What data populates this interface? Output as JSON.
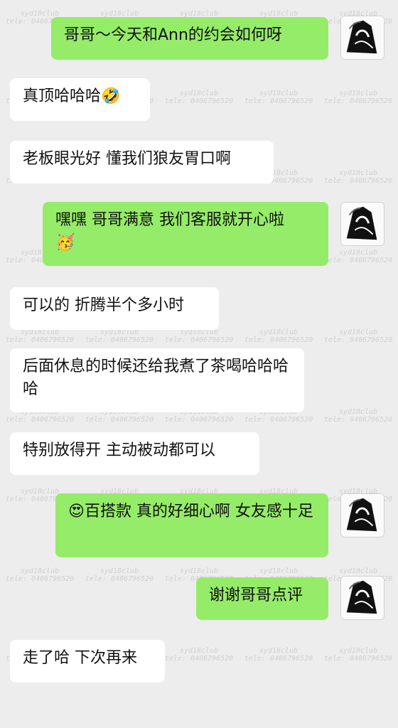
{
  "watermark": {
    "line1": "syd18club",
    "line2": "tele: 0406796520"
  },
  "messages": [
    {
      "side": "right",
      "text": "哥哥～今天和Ann的约会如何呀"
    },
    {
      "side": "left",
      "text": "真顶哈哈哈",
      "emoji": "🤣"
    },
    {
      "side": "left",
      "text": "老板眼光好 懂我们狼友胃口啊"
    },
    {
      "side": "right",
      "text": "嘿嘿 哥哥满意 我们客服就开心啦",
      "emoji": "🥳"
    },
    {
      "side": "left",
      "text": "可以的 折腾半个多小时"
    },
    {
      "side": "left",
      "text": "后面休息的时候还给我煮了茶喝哈哈哈哈"
    },
    {
      "side": "left",
      "text": "特别放得开 主动被动都可以"
    },
    {
      "side": "right",
      "text": "百搭款 真的好细心啊 女友感十足",
      "emoji": "😍"
    },
    {
      "side": "right",
      "text": "谢谢哥哥点评"
    },
    {
      "side": "left",
      "text": "走了哈 下次再来"
    }
  ],
  "colors": {
    "background": "#ededed",
    "left_bubble": "#ffffff",
    "right_bubble": "#95ec69"
  },
  "icons": {
    "avatar": "avatar-icon"
  }
}
